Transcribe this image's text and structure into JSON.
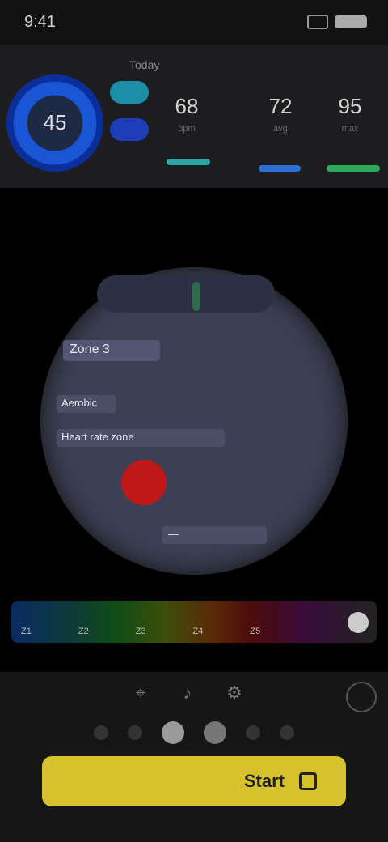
{
  "status": {
    "time": "9:41"
  },
  "header": {
    "caption": "Today",
    "dial_value": "45",
    "metrics": [
      {
        "value": "68",
        "label": "bpm",
        "color": "#2aa6a8"
      },
      {
        "value": "72",
        "label": "avg",
        "color": "#2a6fd6"
      },
      {
        "value": "95",
        "label": "max",
        "color": "#2ea85c"
      }
    ]
  },
  "dial": {
    "lines": [
      "Zone 3",
      "Aerobic",
      "Heart rate zone",
      "—"
    ],
    "marker_color": "#c01818"
  },
  "spectrum": {
    "labels": [
      "Z1",
      "Z2",
      "Z3",
      "Z4",
      "Z5"
    ],
    "colors": [
      "#1e55c8",
      "#1a9a3a",
      "#c2a21a",
      "#c2261a",
      "#8a2aa8"
    ]
  },
  "toolbar": {
    "icons": [
      "location-icon",
      "music-icon",
      "settings-icon"
    ]
  },
  "pager": {
    "count": 6,
    "active": 2
  },
  "start": {
    "label": "Start",
    "icon": "stop-icon",
    "color": "#d6c22c"
  }
}
